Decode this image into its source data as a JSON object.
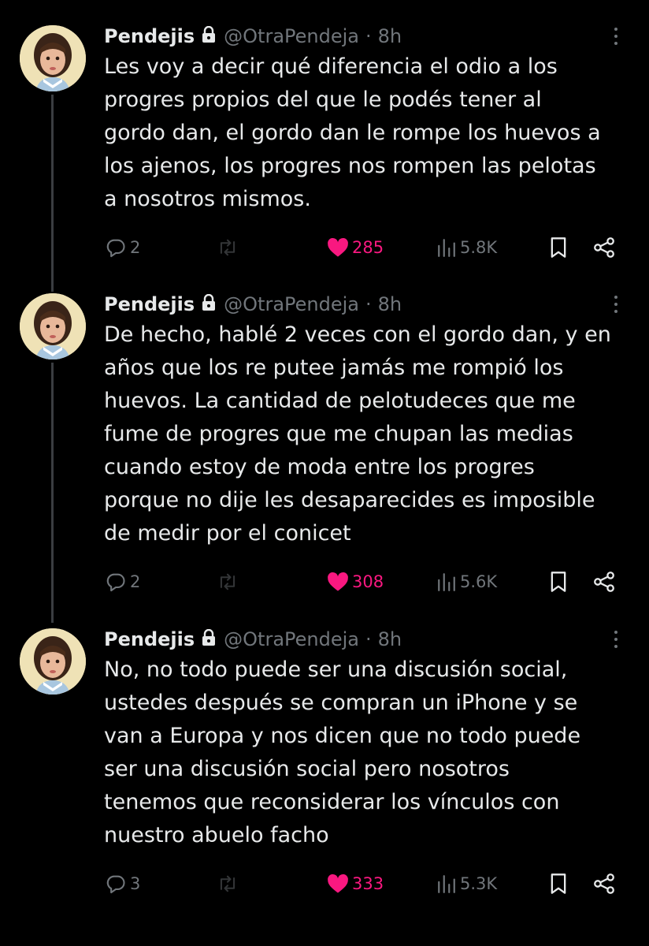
{
  "tweets": [
    {
      "display_name": "Pendejis",
      "handle": "@OtraPendeja",
      "separator": "·",
      "time": "8h",
      "lines": [
        "Les voy a decir qué diferencia el odio a los",
        "progres propios del que le podés tener al",
        "gordo dan, el gordo dan le rompe los huevos a",
        "los ajenos, los progres nos rompen las pelotas",
        "a nosotros mismos."
      ],
      "replies": "2",
      "likes": "285",
      "views": "5.8K"
    },
    {
      "display_name": "Pendejis",
      "handle": "@OtraPendeja",
      "separator": "·",
      "time": "8h",
      "lines": [
        "De hecho, hablé 2 veces con el gordo dan, y en",
        "años que los re putee jamás me rompió los",
        "huevos. La cantidad de pelotudeces que me",
        "fume de progres que me chupan las medias",
        "cuando estoy de moda entre los progres",
        "porque no dije les desaparecides es imposible",
        "de medir por el conicet"
      ],
      "replies": "2",
      "likes": "308",
      "views": "5.6K"
    },
    {
      "display_name": "Pendejis",
      "handle": "@OtraPendeja",
      "separator": "·",
      "time": "8h",
      "lines": [
        "No, no todo puede ser una discusión social,",
        "ustedes después se compran un iPhone y se",
        "van a Europa y nos dicen que no todo puede",
        "ser una discusión social pero nosotros",
        "tenemos que reconsiderar los vínculos con",
        "nuestro abuelo facho"
      ],
      "replies": "3",
      "likes": "333",
      "views": "5.3K"
    }
  ],
  "icons": {
    "reply": "reply-icon",
    "repost": "repost-icon",
    "like": "heart-icon",
    "views": "views-icon",
    "bookmark": "bookmark-icon",
    "share": "share-icon",
    "lock": "lock-icon",
    "more": "more-options-icon"
  },
  "colors": {
    "background": "#000000",
    "text": "#e7e9ea",
    "muted": "#71767b",
    "like": "#f91880",
    "thread_line": "#3a3d41"
  }
}
